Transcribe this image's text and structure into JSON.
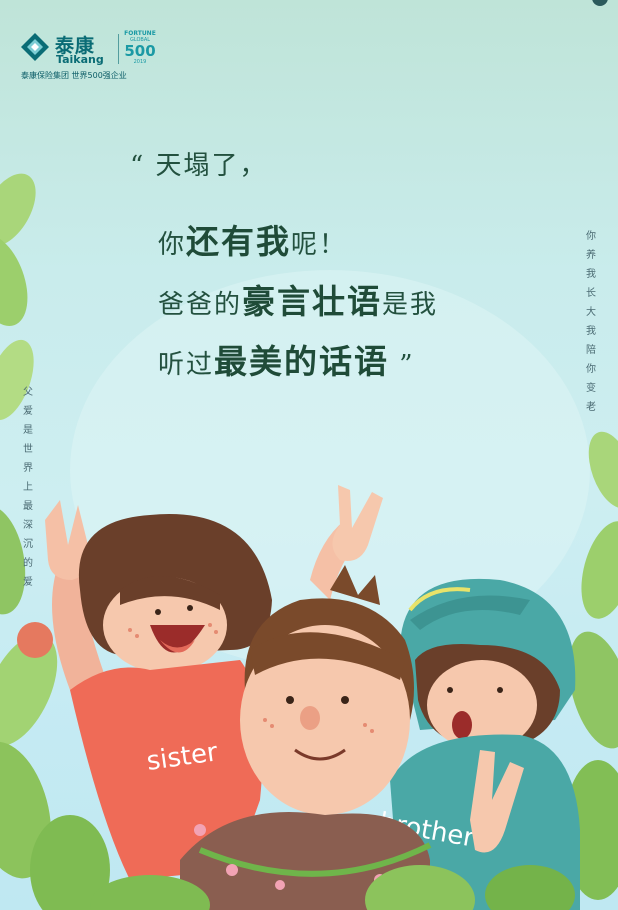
{
  "logo": {
    "cn": "泰康",
    "en": "Taikang",
    "fortune_top": "FORTUNE",
    "fortune_mid": "GLOBAL",
    "fortune_num": "500",
    "fortune_year": "2019",
    "tagline": "泰康保险集团 世界500强企业"
  },
  "quote": {
    "line1": "“ 天塌了，",
    "line2_pre": "你",
    "line2_bold": "还有我",
    "line2_post": "呢！",
    "line3_pre": "爸爸的",
    "line3_bold": "豪言壮语",
    "line3_post": "是我",
    "line4_pre": "听过",
    "line4_bold": "最美的话语",
    "line4_post": " ”"
  },
  "side_left": [
    "父",
    "爱",
    "是",
    "世",
    "界",
    "上",
    "最",
    "深",
    "沉",
    "的",
    "爱"
  ],
  "side_right": [
    "你",
    "养",
    "我",
    "长",
    "大",
    "我",
    "陪",
    "你",
    "变",
    "老"
  ],
  "shirts": {
    "sister": "sister",
    "brother": "brother"
  },
  "colors": {
    "brand": "#0a6c75",
    "quote": "#23513f",
    "sister_shirt": "#ef6b57",
    "brother_shirt": "#4aa8a6"
  }
}
